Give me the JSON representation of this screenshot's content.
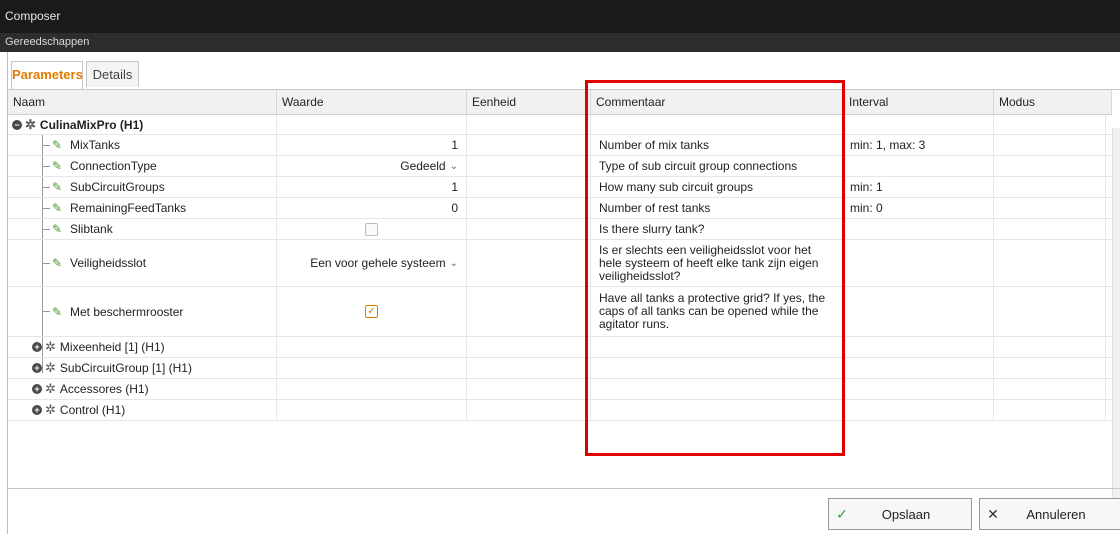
{
  "window": {
    "title": "Composer",
    "subtitle": "Gereedschappen"
  },
  "tabs": [
    {
      "label": "Parameters",
      "active": true
    },
    {
      "label": "Details",
      "active": false
    }
  ],
  "columns": [
    "Naam",
    "Waarde",
    "Eenheid",
    "Commentaar",
    "Interval",
    "Modus"
  ],
  "root": {
    "label": "CulinaMixPro (H1)"
  },
  "params": [
    {
      "name": "MixTanks",
      "value": "1",
      "unit": "",
      "comment": "Number of mix tanks",
      "interval": "min: 1, max: 3"
    },
    {
      "name": "ConnectionType",
      "value": "Gedeeld",
      "unit": "",
      "comment": "Type of sub circuit group connections",
      "interval": ""
    },
    {
      "name": "SubCircuitGroups",
      "value": "1",
      "unit": "",
      "comment": "How many sub circuit groups",
      "interval": "min: 1"
    },
    {
      "name": "RemainingFeedTanks",
      "value": "0",
      "unit": "",
      "comment": "Number of rest tanks",
      "interval": "min: 0"
    },
    {
      "name": "Slibtank",
      "value": "",
      "unit": "",
      "comment": "Is there slurry tank?",
      "interval": ""
    },
    {
      "name": "Veiligheidsslot",
      "value": "Een voor gehele systeem",
      "unit": "",
      "comment": "Is er slechts een veiligheidsslot voor het hele systeem of heeft elke tank zijn eigen veiligheidsslot?",
      "interval": ""
    },
    {
      "name": "Met beschermrooster",
      "value": "",
      "unit": "",
      "comment": "Have all tanks a protective grid? If yes, the caps of all tanks can be opened while the agitator runs.",
      "interval": ""
    }
  ],
  "children": [
    {
      "label": "Mixeenheid [1] (H1)"
    },
    {
      "label": "SubCircuitGroup [1] (H1)"
    },
    {
      "label": "Accessores (H1)"
    },
    {
      "label": "Control (H1)"
    }
  ],
  "checkboxes": {
    "slibtank": false,
    "met_beschermrooster": true
  },
  "buttons": {
    "save": "Opslaan",
    "cancel": "Annuleren"
  },
  "colors": {
    "accent": "#e07b00",
    "highlight": "#e00000",
    "ok": "#3aa13a"
  }
}
